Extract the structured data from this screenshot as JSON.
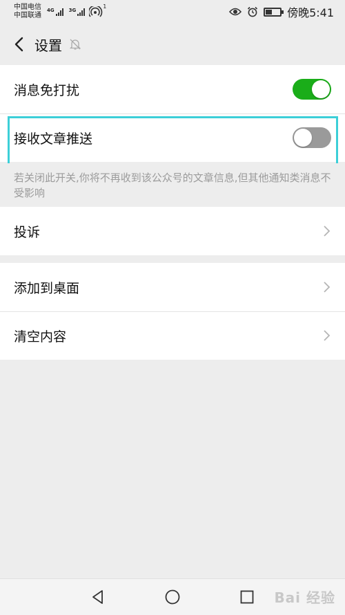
{
  "status_bar": {
    "carrier_1": "中国电信",
    "carrier_2": "中国联通",
    "network_1": "4G",
    "network_2": "3G",
    "hotspot_count": "1",
    "time": "傍晚5:41",
    "icons": [
      "eye-icon",
      "alarm-icon",
      "battery-icon"
    ]
  },
  "header": {
    "title": "设置",
    "back_icon": "chevron-left-icon",
    "mute_icon": "bell-off-icon"
  },
  "settings": {
    "dnd_label": "消息免打扰",
    "dnd_on": true,
    "push_label": "接收文章推送",
    "push_on": false,
    "push_hint": "若关闭此开关,你将不再收到该公众号的文章信息,但其他通知类消息不受影响",
    "complain_label": "投诉",
    "add_desktop_label": "添加到桌面",
    "clear_label": "清空内容"
  },
  "colors": {
    "toggle_on": "#1aad19",
    "toggle_off": "#9a9a9a",
    "highlight": "#3ccfd8"
  },
  "nav_bar": {
    "icons": [
      "back-triangle-icon",
      "home-circle-icon",
      "recents-square-icon"
    ]
  },
  "watermark": "Bai 经验"
}
